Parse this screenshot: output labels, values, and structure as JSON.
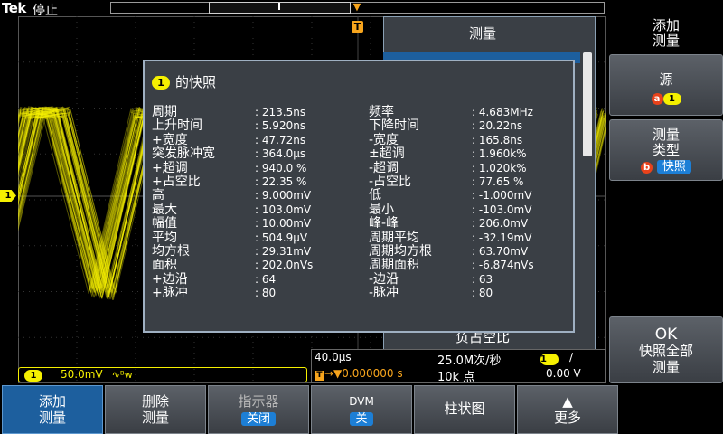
{
  "top": {
    "brand": "Tek",
    "status": "停止"
  },
  "trigger": {
    "marker": "T"
  },
  "channel": {
    "marker": "1"
  },
  "measure_panel": {
    "title": "测量",
    "bottom_item": "负占空比"
  },
  "snapshot": {
    "channel": "1",
    "title": "的快照",
    "rows": [
      {
        "l1": "周期",
        "v1": ": 213.5ns",
        "l2": "频率",
        "v2": ": 4.683MHz"
      },
      {
        "l1": "上升时间",
        "v1": ": 5.920ns",
        "l2": "下降时间",
        "v2": ": 20.22ns"
      },
      {
        "l1": "+宽度",
        "v1": ": 47.72ns",
        "l2": "-宽度",
        "v2": ": 165.8ns"
      },
      {
        "l1": "突发脉冲宽",
        "v1": ": 364.0µs",
        "l2": "±超调",
        "v2": ": 1.960k%"
      },
      {
        "l1": "+超调",
        "v1": ": 940.0 %",
        "l2": "-超调",
        "v2": ": 1.020k%"
      },
      {
        "l1": "+占空比",
        "v1": ": 22.35 %",
        "l2": "-占空比",
        "v2": ": 77.65 %"
      },
      {
        "l1": "高",
        "v1": ": 9.000mV",
        "l2": "低",
        "v2": ": -1.000mV"
      },
      {
        "l1": "最大",
        "v1": ": 103.0mV",
        "l2": "最小",
        "v2": ": -103.0mV"
      },
      {
        "l1": "幅值",
        "v1": ": 10.00mV",
        "l2": "峰-峰",
        "v2": ": 206.0mV"
      },
      {
        "l1": "平均",
        "v1": ": 504.9µV",
        "l2": "周期平均",
        "v2": ": -32.19mV"
      },
      {
        "l1": "均方根",
        "v1": ": 29.31mV",
        "l2": "周期均方根",
        "v2": ": 63.70mV"
      },
      {
        "l1": "面积",
        "v1": ": 202.0nVs",
        "l2": "周期面积",
        "v2": ": -6.874nVs"
      },
      {
        "l1": "+边沿",
        "v1": ": 64",
        "l2": "-边沿",
        "v2": ": 63"
      },
      {
        "l1": "+脉冲",
        "v1": ": 80",
        "l2": "-脉冲",
        "v2": ": 80"
      }
    ]
  },
  "right_keys": {
    "title_line1": "添加",
    "title_line2": "测量",
    "source_label": "源",
    "source_badge": "a",
    "source_value": "1",
    "type_line1": "测量",
    "type_line2": "类型",
    "type_badge": "b",
    "type_value": "快照",
    "ok_line1": "OK",
    "ok_line2": "快照全部",
    "ok_line3": "测量"
  },
  "readout": {
    "channel": "1",
    "scale": "50.0mV",
    "bw_icon": "∿ᴮw",
    "time_per_div": "40.0µs",
    "sample_rate": "25.0M次/秒",
    "trig_channel": "1",
    "slope": "∕",
    "trig_offset": "→▼0.000000 s",
    "record_length": "10k 点",
    "trig_level": "0.00 V"
  },
  "bottom_keys": [
    {
      "line1": "添加",
      "line2": "测量",
      "active": true
    },
    {
      "line1": "删除",
      "line2": "测量"
    },
    {
      "line1": "指示器",
      "chip": "关闭"
    },
    {
      "line1": "DVM",
      "chip": "关"
    },
    {
      "line1": "柱状图"
    },
    {
      "line1": "▲",
      "line2": "更多"
    }
  ],
  "colors": {
    "channel1": "#f5f000",
    "trigger": "#f7a51d",
    "panel": "#3a3f45",
    "active_key": "#1d5f9e"
  }
}
